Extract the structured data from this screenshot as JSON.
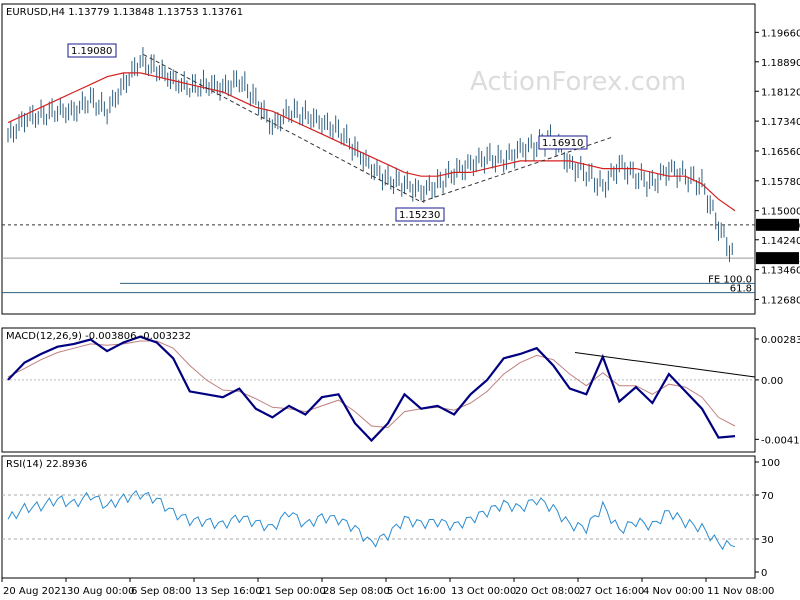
{
  "chart_data": {
    "type": "ohlc",
    "watermark": "ActionForex.com",
    "x_labels": [
      "20 Aug 2021",
      "30 Aug 00:00",
      "6 Sep 08:00",
      "13 Sep 16:00",
      "21 Sep 00:00",
      "28 Sep 08:00",
      "5 Oct 16:00",
      "13 Oct 00:00",
      "20 Oct 08:00",
      "27 Oct 16:00",
      "4 Nov 00:00",
      "11 Nov 08:00"
    ],
    "price_panel": {
      "header": "EURUSD,H4  1.13779 1.13848 1.13753 1.13761",
      "ylim": [
        1.123,
        1.204
      ],
      "ticks": [
        "1.19660",
        "1.18890",
        "1.18120",
        "1.17340",
        "1.16560",
        "1.15780",
        "1.15000",
        "1.14240",
        "1.13460",
        "1.12680"
      ],
      "close_series": [
        1.169,
        1.174,
        1.175,
        1.176,
        1.176,
        1.179,
        1.176,
        1.183,
        1.189,
        1.187,
        1.184,
        1.182,
        1.183,
        1.182,
        1.184,
        1.179,
        1.172,
        1.176,
        1.175,
        1.173,
        1.171,
        1.166,
        1.161,
        1.158,
        1.157,
        1.155,
        1.157,
        1.16,
        1.162,
        1.164,
        1.163,
        1.166,
        1.167,
        1.169,
        1.162,
        1.16,
        1.156,
        1.162,
        1.159,
        1.157,
        1.161,
        1.159,
        1.157,
        1.146,
        1.137
      ],
      "ma_series": [
        1.173,
        1.175,
        1.177,
        1.179,
        1.181,
        1.183,
        1.185,
        1.186,
        1.186,
        1.185,
        1.184,
        1.183,
        1.182,
        1.181,
        1.179,
        1.177,
        1.176,
        1.174,
        1.172,
        1.17,
        1.168,
        1.166,
        1.164,
        1.162,
        1.16,
        1.159,
        1.159,
        1.16,
        1.16,
        1.161,
        1.162,
        1.163,
        1.163,
        1.163,
        1.163,
        1.162,
        1.161,
        1.161,
        1.161,
        1.16,
        1.159,
        1.159,
        1.157,
        1.153,
        1.15
      ],
      "annotations": [
        {
          "text": "1.19080",
          "value": 1.1908
        },
        {
          "text": "1.15230",
          "value": 1.1523
        },
        {
          "text": "1.16910",
          "value": 1.1691
        }
      ],
      "hlines": [
        {
          "value": 1.1463,
          "label": "1.14630"
        },
        {
          "value": 1.1376,
          "label": "1.13761"
        }
      ],
      "fe_lines": [
        {
          "value": 1.131,
          "label": "FE 100.0"
        },
        {
          "value": 1.1286,
          "label": "61.8"
        }
      ]
    },
    "macd_panel": {
      "header": "MACD(12,26,9) -0.003806 -0.003232",
      "ticks": [
        "0.002839",
        "0.00",
        "-0.004123"
      ],
      "ylim": [
        -0.005,
        0.0036
      ],
      "macd_series": [
        0.0,
        0.0012,
        0.0018,
        0.0023,
        0.0025,
        0.0028,
        0.002,
        0.0026,
        0.003,
        0.0026,
        0.0015,
        -0.0008,
        -0.001,
        -0.0012,
        -0.0006,
        -0.002,
        -0.0026,
        -0.0018,
        -0.0024,
        -0.0012,
        -0.001,
        -0.003,
        -0.0042,
        -0.003,
        -0.001,
        -0.002,
        -0.0018,
        -0.0024,
        -0.001,
        0.0,
        0.0015,
        0.0018,
        0.0022,
        0.001,
        -0.0006,
        -0.001,
        0.0016,
        -0.0015,
        -0.0005,
        -0.0016,
        0.0004,
        -0.0008,
        -0.002,
        -0.004,
        -0.0039
      ],
      "signal_series": [
        0.0002,
        0.0008,
        0.0014,
        0.0019,
        0.0022,
        0.0025,
        0.0024,
        0.0025,
        0.0027,
        0.0027,
        0.0022,
        0.001,
        0.0,
        -0.0007,
        -0.0008,
        -0.0013,
        -0.0019,
        -0.002,
        -0.0022,
        -0.0018,
        -0.0014,
        -0.0022,
        -0.0032,
        -0.0033,
        -0.0022,
        -0.002,
        -0.0019,
        -0.0021,
        -0.0016,
        -0.0008,
        0.0004,
        0.0012,
        0.0017,
        0.0014,
        0.0004,
        -0.0004,
        0.0005,
        -0.0004,
        -0.0004,
        -0.001,
        -0.0003,
        -0.0005,
        -0.0012,
        -0.0026,
        -0.0032
      ],
      "trendline": {
        "start": 0.0019,
        "end": 0.0002
      }
    },
    "rsi_panel": {
      "header": "RSI(14) 22.8936",
      "ticks": [
        "100",
        "70",
        "30",
        "0"
      ],
      "levels": [
        70,
        30
      ],
      "ylim": [
        0,
        100
      ],
      "rsi_series": [
        48,
        58,
        60,
        66,
        62,
        70,
        60,
        67,
        71,
        66,
        54,
        47,
        46,
        43,
        50,
        45,
        40,
        55,
        43,
        50,
        48,
        40,
        26,
        34,
        48,
        44,
        46,
        42,
        48,
        55,
        62,
        58,
        66,
        58,
        43,
        40,
        60,
        38,
        46,
        42,
        55,
        45,
        40,
        26,
        23
      ]
    }
  }
}
